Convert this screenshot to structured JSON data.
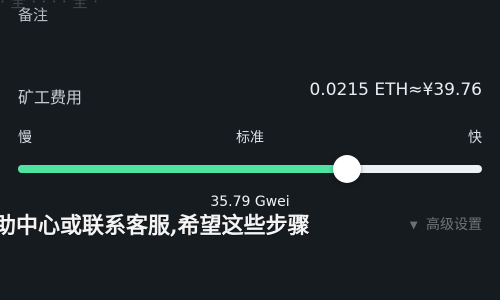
{
  "page": {
    "colors": {
      "background": "#161b20",
      "accent": "#4fe3a1",
      "track": "#eef1f3",
      "text": "#d7dde3"
    }
  },
  "header": {
    "note_label": "备注",
    "top_fragment": "· 全 ·  · ·  · 全 ·"
  },
  "fee": {
    "label": "矿工费用",
    "value": "0.0215 ETH≈¥39.76"
  },
  "speed": {
    "slow": "慢",
    "standard": "标准",
    "fast": "快",
    "selected_fraction": 0.71
  },
  "gas": {
    "price": "35.79 Gwei"
  },
  "overlay_text": "助中心或联系客服,希望这些步骤",
  "advanced": {
    "label": "高级设置",
    "icon": "triangle-down-icon"
  }
}
